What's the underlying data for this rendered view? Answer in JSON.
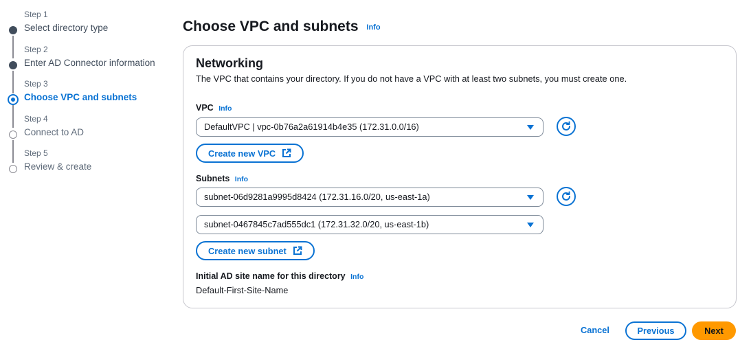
{
  "steps": [
    {
      "num": "Step 1",
      "title": "Select directory type",
      "state": "done"
    },
    {
      "num": "Step 2",
      "title": "Enter AD Connector information",
      "state": "done"
    },
    {
      "num": "Step 3",
      "title": "Choose VPC and subnets",
      "state": "current"
    },
    {
      "num": "Step 4",
      "title": "Connect to AD",
      "state": "pending"
    },
    {
      "num": "Step 5",
      "title": "Review & create",
      "state": "pending"
    }
  ],
  "page": {
    "title": "Choose VPC and subnets",
    "info": "Info"
  },
  "networking": {
    "title": "Networking",
    "description": "The VPC that contains your directory. If you do not have a VPC with at least two subnets, you must create one.",
    "vpc": {
      "label": "VPC",
      "info": "Info",
      "value": "DefaultVPC | vpc-0b76a2a61914b4e35 (172.31.0.0/16)",
      "create_button": "Create new VPC"
    },
    "subnets": {
      "label": "Subnets",
      "info": "Info",
      "values": [
        "subnet-06d9281a9995d8424 (172.31.16.0/20, us-east-1a)",
        "subnet-0467845c7ad555dc1 (172.31.32.0/20, us-east-1b)"
      ],
      "create_button": "Create new subnet"
    },
    "ad_site": {
      "label": "Initial AD site name for this directory",
      "info": "Info",
      "value": "Default-First-Site-Name"
    }
  },
  "footer": {
    "cancel": "Cancel",
    "previous": "Previous",
    "next": "Next"
  },
  "colors": {
    "accent": "#0972d3",
    "primary_button": "#ff9900",
    "border": "#7d8998"
  }
}
